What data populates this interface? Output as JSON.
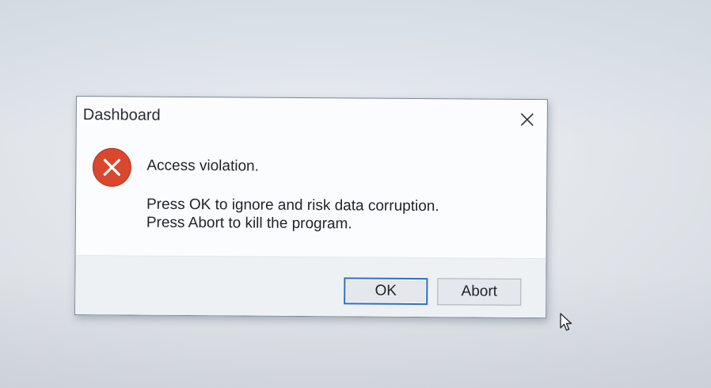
{
  "dialog": {
    "title": "Dashboard",
    "close_icon": "close-icon",
    "message_icon": "error-icon",
    "message_headline": "Access violation.",
    "message_lines": [
      "Press OK to ignore and risk data corruption.",
      "Press Abort to kill the program."
    ],
    "buttons": {
      "ok_label": "OK",
      "abort_label": "Abort"
    },
    "default_button": "OK"
  },
  "colors": {
    "error_icon": "#d9472f",
    "focus_border": "#2f6fc4",
    "footer_background": "#eef1f4",
    "dialog_background": "#fbfcfd"
  },
  "cursor": {
    "icon": "mouse-pointer-icon"
  }
}
